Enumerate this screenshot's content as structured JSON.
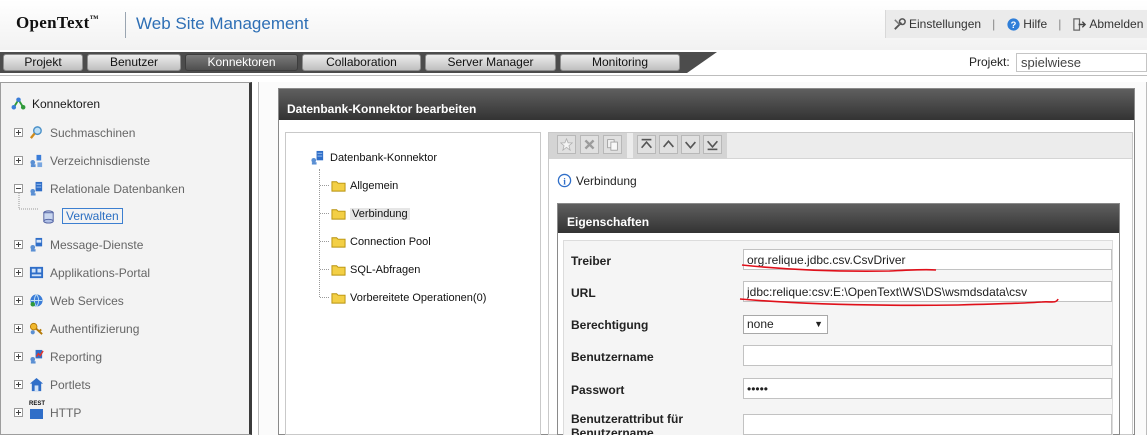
{
  "header": {
    "logo_main": "OpenText",
    "logo_tm": "™",
    "product": "Web Site Management",
    "links": [
      {
        "label": "Einstellungen",
        "icon": "settings-icon"
      },
      {
        "label": "Hilfe",
        "icon": "help-icon"
      },
      {
        "label": "Abmelden",
        "icon": "logout-icon"
      }
    ]
  },
  "nav": {
    "tabs": [
      "Projekt",
      "Benutzer",
      "Konnektoren",
      "Collaboration",
      "Server Manager",
      "Monitoring"
    ],
    "active_tab": "Konnektoren",
    "projekt_label": "Projekt:",
    "projekt_value": "spielwiese"
  },
  "sidebar": {
    "root": "Konnektoren",
    "items": [
      {
        "label": "Suchmaschinen",
        "expanded": false
      },
      {
        "label": "Verzeichnisdienste",
        "expanded": false
      },
      {
        "label": "Relationale Datenbanken",
        "expanded": true
      },
      {
        "label": "Message-Dienste",
        "expanded": false
      },
      {
        "label": "Applikations-Portal",
        "expanded": false
      },
      {
        "label": "Web Services",
        "expanded": false
      },
      {
        "label": "Authentifizierung",
        "expanded": false
      },
      {
        "label": "Reporting",
        "expanded": false
      },
      {
        "label": "Portlets",
        "expanded": false
      },
      {
        "label": "HTTP",
        "expanded": false
      }
    ],
    "selected_child": "Verwalten",
    "http_icon_text": "REST"
  },
  "dialog": {
    "title": "Datenbank-Konnektor bearbeiten",
    "tree": {
      "root": "Datenbank-Konnektor",
      "items": [
        "Allgemein",
        "Verbindung",
        "Connection Pool",
        "SQL-Abfragen",
        "Vorbereitete Operationen(0)"
      ],
      "selected": "Verbindung"
    },
    "section": "Verbindung",
    "properties": {
      "title": "Eigenschaften",
      "fields": {
        "treiber_label": "Treiber",
        "treiber_value": "org.relique.jdbc.csv.CsvDriver",
        "url_label": "URL",
        "url_value": "jdbc:relique:csv:E:\\OpenText\\WS\\DS\\wsmdsdata\\csv",
        "berechtigung_label": "Berechtigung",
        "berechtigung_value": "none",
        "benutzername_label": "Benutzername",
        "benutzername_value": "",
        "passwort_label": "Passwort",
        "passwort_value": "•••••",
        "benutzerattribut_label_1": "Benutzerattribut für",
        "benutzerattribut_label_2": "Benutzername",
        "benutzerattribut_value": ""
      }
    }
  },
  "colors": {
    "accent_blue": "#2e6fb5",
    "annotation_red": "#e0101a",
    "title_bar_dark": "#3d3d3d"
  }
}
